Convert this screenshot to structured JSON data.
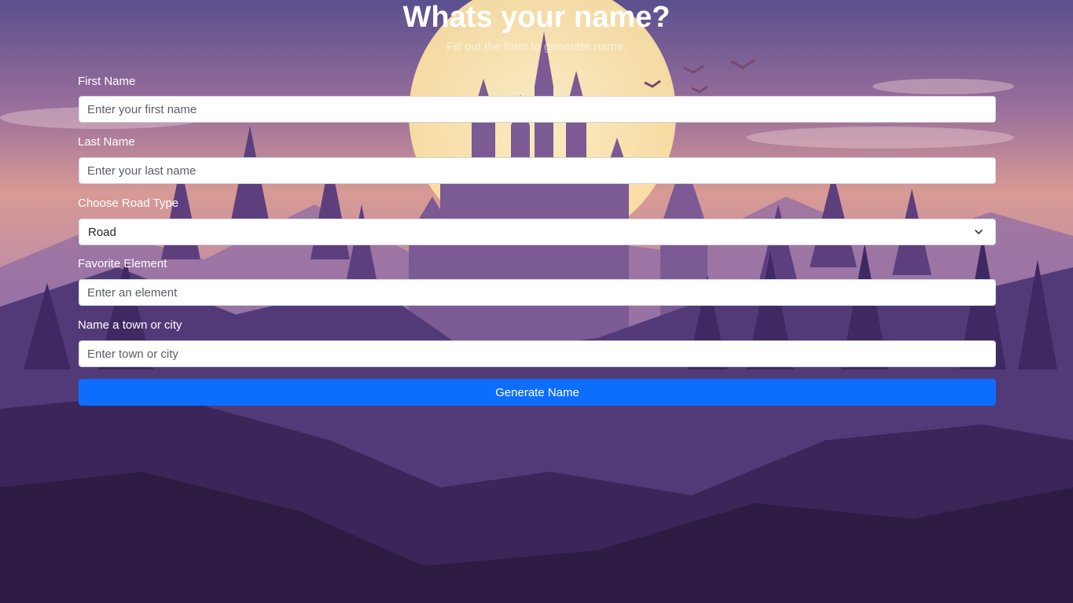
{
  "header": {
    "title": "Whats your name?",
    "subtitle": "Fill out the form to generate name."
  },
  "form": {
    "first_name": {
      "label": "First Name",
      "placeholder": "Enter your first name",
      "value": ""
    },
    "last_name": {
      "label": "Last Name",
      "placeholder": "Enter your last name",
      "value": ""
    },
    "road_type": {
      "label": "Choose Road Type",
      "selected": "Road"
    },
    "element": {
      "label": "Favorite Element",
      "placeholder": "Enter an element",
      "value": ""
    },
    "town": {
      "label": "Name a town or city",
      "placeholder": "Enter town or city",
      "value": ""
    },
    "submit_label": "Generate Name"
  },
  "colors": {
    "accent": "#0d6efd",
    "sky_top": "#5a4e8c",
    "sky_mid": "#b97a8f",
    "sun": "#fde9b0",
    "ground": "#2d1b44"
  },
  "icons": {
    "select_indicator": "chevron-down-icon"
  }
}
